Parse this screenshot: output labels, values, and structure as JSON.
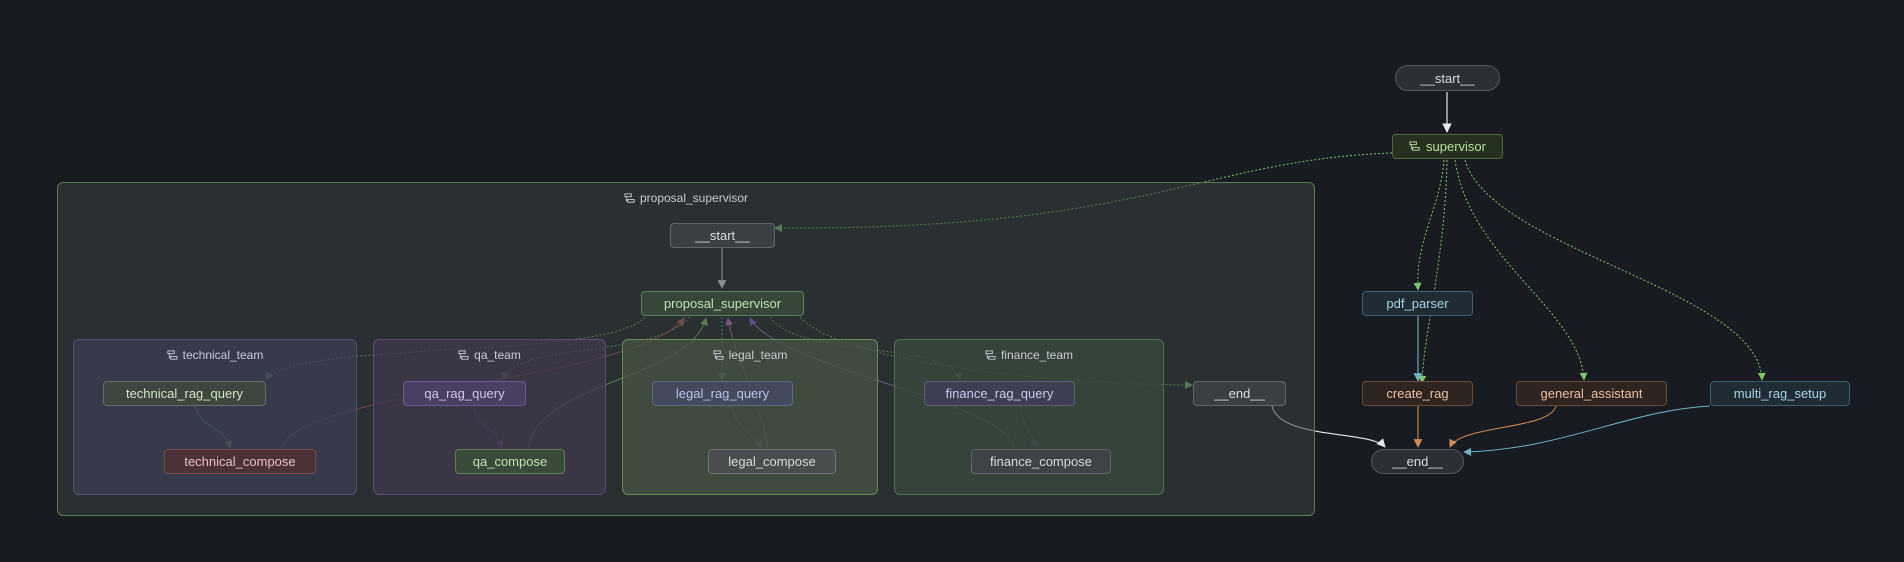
{
  "graph": {
    "groups": {
      "proposal_supervisor": "proposal_supervisor",
      "technical_team": "technical_team",
      "qa_team": "qa_team",
      "legal_team": "legal_team",
      "finance_team": "finance_team"
    },
    "nodes": {
      "outer_start": "__start__",
      "supervisor": "supervisor",
      "pdf_parser": "pdf_parser",
      "create_rag": "create_rag",
      "general_assistant": "general_assistant",
      "multi_rag_setup": "multi_rag_setup",
      "outer_end": "__end__",
      "inner_start": "__start__",
      "proposal_supervisor": "proposal_supervisor",
      "inner_end": "__end__",
      "technical_rag_query": "technical_rag_query",
      "technical_compose": "technical_compose",
      "qa_rag_query": "qa_rag_query",
      "qa_compose": "qa_compose",
      "legal_rag_query": "legal_rag_query",
      "legal_compose": "legal_compose",
      "finance_rag_query": "finance_rag_query",
      "finance_compose": "finance_compose"
    },
    "icon": "subgraph-icon"
  },
  "colors": {
    "background": "#181b21",
    "green": "#7fc46a",
    "purple": "#8a5cd6",
    "red": "#c0504d",
    "orange": "#d08a52",
    "cyan": "#6fb3c7",
    "white": "#e6e9ed"
  }
}
